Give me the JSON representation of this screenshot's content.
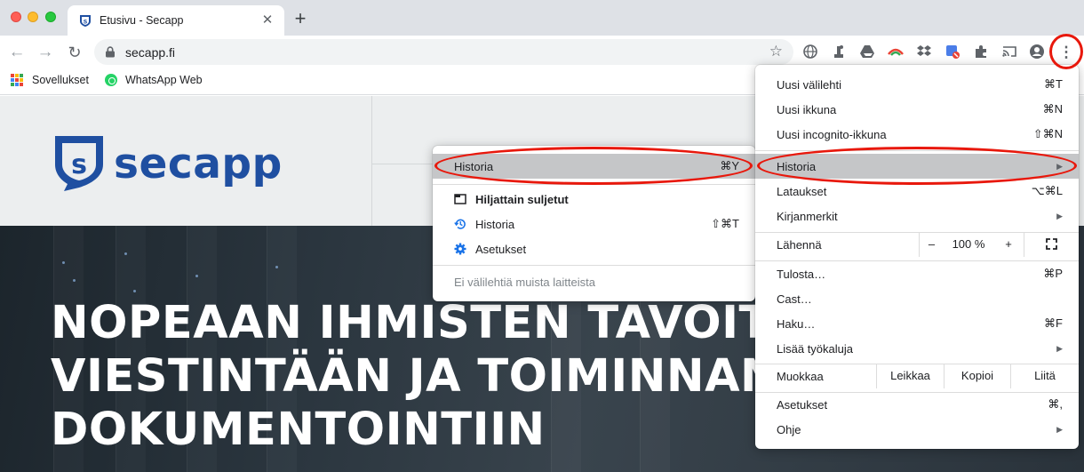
{
  "tab": {
    "title": "Etusivu - Secapp",
    "favicon": "secapp-shield-icon",
    "close": "✕"
  },
  "toolbar": {
    "url": "secapp.fi",
    "new_tab": "+"
  },
  "bookmarks": [
    {
      "label": "Sovellukset",
      "icon": "apps-grid-icon"
    },
    {
      "label": "WhatsApp Web",
      "icon": "whatsapp-icon"
    }
  ],
  "page": {
    "logo_text": "secapp",
    "logo_letter": "s",
    "headline": [
      "NOPEAAN IHMISTEN TAVOITTA",
      "VIESTINTÄÄN JA TOIMINNAN",
      "DOKUMENTOINTIIN"
    ]
  },
  "main_menu": {
    "items": [
      {
        "label": "Uusi välilehti",
        "shortcut": "⌘T"
      },
      {
        "label": "Uusi ikkuna",
        "shortcut": "⌘N"
      },
      {
        "label": "Uusi incognito-ikkuna",
        "shortcut": "⇧⌘N"
      },
      {
        "label": "Historia",
        "submenu": true
      },
      {
        "label": "Lataukset",
        "shortcut": "⌥⌘L"
      },
      {
        "label": "Kirjanmerkit",
        "submenu": true
      }
    ],
    "zoom": {
      "label": "Lähennä",
      "minus": "–",
      "value": "100 %",
      "plus": "+"
    },
    "items2": [
      {
        "label": "Tulosta…",
        "shortcut": "⌘P"
      },
      {
        "label": "Cast…",
        "shortcut": ""
      },
      {
        "label": "Haku…",
        "shortcut": "⌘F"
      },
      {
        "label": "Lisää työkaluja",
        "submenu": true
      }
    ],
    "edit": {
      "label": "Muokkaa",
      "cut": "Leikkaa",
      "copy": "Kopioi",
      "paste": "Liitä"
    },
    "items3": [
      {
        "label": "Asetukset",
        "shortcut": "⌘,"
      },
      {
        "label": "Ohje",
        "submenu": true
      }
    ]
  },
  "history_submenu": {
    "header": {
      "label": "Historia",
      "shortcut": "⌘Y"
    },
    "items": [
      {
        "label": "Hiljattain suljetut",
        "icon": "tab-window-icon"
      },
      {
        "label": "Historia",
        "shortcut": "⇧⌘T",
        "icon": "history-clock-icon"
      },
      {
        "label": "Asetukset",
        "icon": "settings-gear-icon"
      }
    ],
    "footer": "Ei välilehtiä muista laitteista"
  },
  "colors": {
    "accent": "#1a73e8",
    "annotation": "#e8180c",
    "brand": "#1f4fa1"
  }
}
